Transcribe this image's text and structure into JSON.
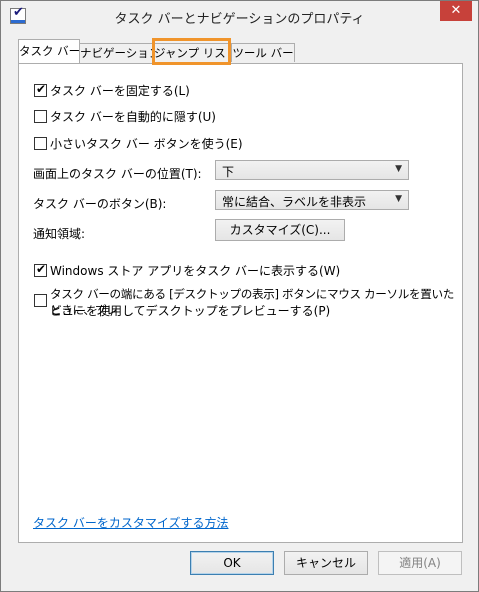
{
  "window": {
    "title": "タスク バーとナビゲーションのプロパティ",
    "close_glyph": "✕"
  },
  "tabs": [
    {
      "label": "タスク バー",
      "active": true
    },
    {
      "label": "ナビゲーション",
      "active": false
    },
    {
      "label": "ジャンプ リスト",
      "active": false,
      "highlighted": true
    },
    {
      "label": "ツール バー",
      "active": false
    }
  ],
  "highlight_color": "#f0942b",
  "options": {
    "lock_taskbar": {
      "label": "タスク バーを固定する(L)",
      "checked": true
    },
    "auto_hide": {
      "label": "タスク バーを自動的に隠す(U)",
      "checked": false
    },
    "small_buttons": {
      "label": "小さいタスク バー ボタンを使う(E)",
      "checked": false
    }
  },
  "position": {
    "label": "画面上のタスク バーの位置(T):",
    "value": "下"
  },
  "buttons_combine": {
    "label": "タスク バーのボタン(B):",
    "value": "常に結合、ラベルを非表示"
  },
  "notification_area": {
    "label": "通知領域:",
    "button_label": "カスタマイズ(C)..."
  },
  "store_apps": {
    "label": "Windows ストア アプリをタスク バーに表示する(W)",
    "checked": true
  },
  "peek": {
    "line1": "タスク バーの端にある [デスクトップの表示] ボタンにマウス カーソルを置いたときに、プレ",
    "line2": "ビューを使用してデスクトップをプレビューする(P)",
    "checked": false
  },
  "help_link": "タスク バーをカスタマイズする方法",
  "footer": {
    "ok": "OK",
    "cancel": "キャンセル",
    "apply": "適用(A)"
  },
  "check_glyph": "✔",
  "dropdown_glyph": "▼"
}
